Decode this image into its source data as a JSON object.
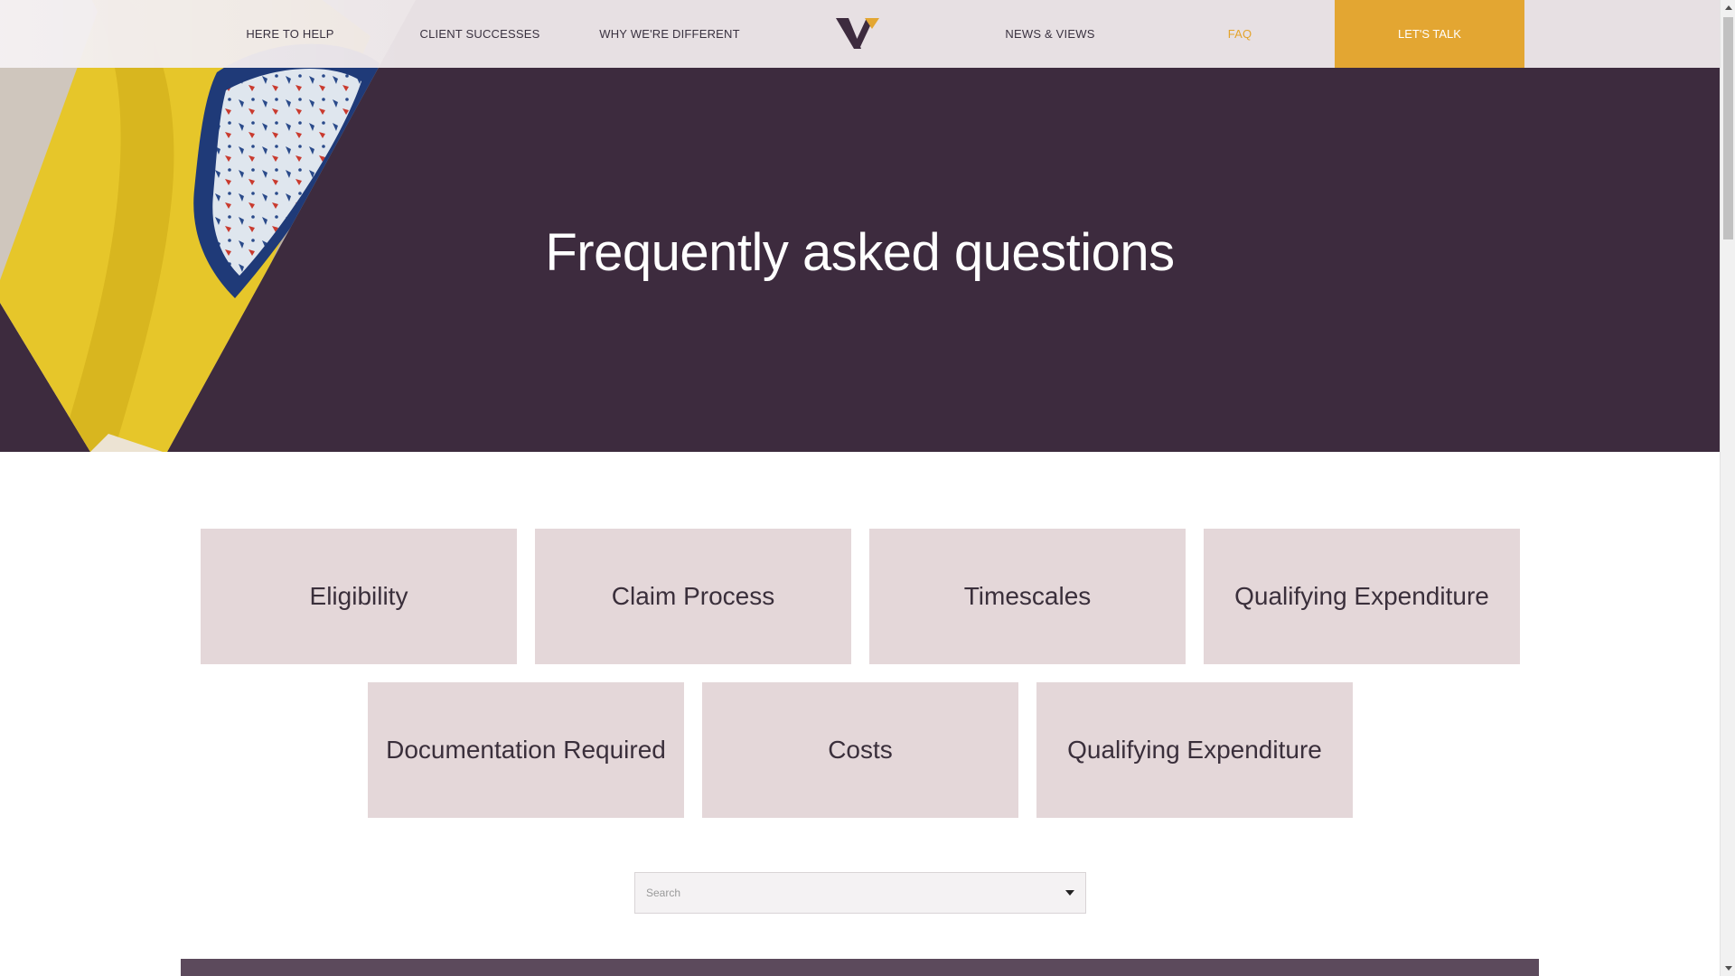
{
  "header": {
    "nav": [
      {
        "label": "HERE TO HELP"
      },
      {
        "label": "CLIENT SUCCESSES"
      },
      {
        "label": "WHY WE'RE DIFFERENT"
      },
      {
        "label": "NEWS & VIEWS"
      },
      {
        "label": "FAQ",
        "active": true
      }
    ],
    "cta_label": "LET'S TALK",
    "logo_icon": "v-logo-icon"
  },
  "hero": {
    "title": "Frequently asked questions"
  },
  "categories": [
    {
      "label": "Eligibility"
    },
    {
      "label": "Claim Process"
    },
    {
      "label": "Timescales"
    },
    {
      "label": "Qualifying Expenditure"
    },
    {
      "label": "Documentation Required"
    },
    {
      "label": "Costs"
    },
    {
      "label": "Qualifying Expenditure"
    }
  ],
  "search": {
    "placeholder": "Search",
    "value": ""
  },
  "colors": {
    "brand_purple": "#3d2b3e",
    "accent_gold": "#e3a632",
    "tile_bg": "#e4d7d9",
    "header_bg": "#eee8ea"
  }
}
